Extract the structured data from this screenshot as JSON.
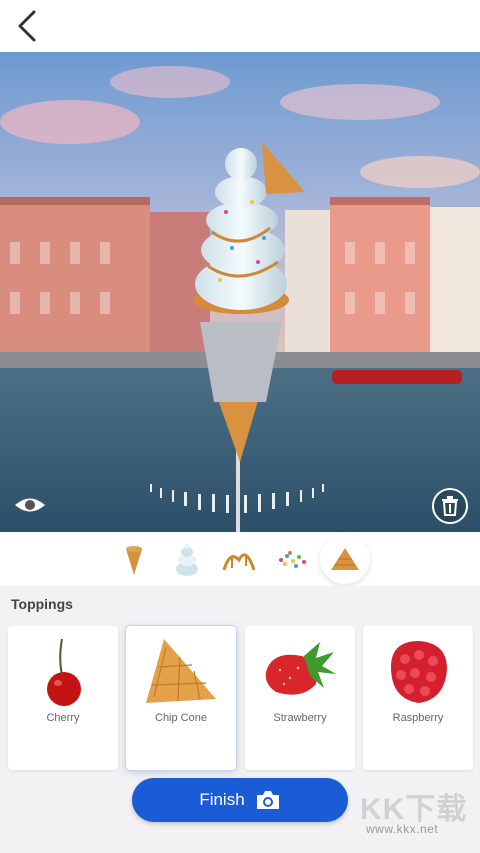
{
  "toppings_section": {
    "title": "Toppings",
    "items": [
      {
        "label": "Cherry",
        "icon": "cherry-icon"
      },
      {
        "label": "Chip Cone",
        "icon": "chip-cone-icon",
        "selected": true
      },
      {
        "label": "Strawberry",
        "icon": "strawberry-icon"
      },
      {
        "label": "Raspberry",
        "icon": "raspberry-icon"
      }
    ]
  },
  "categories": [
    {
      "name": "cone",
      "icon": "cone-icon"
    },
    {
      "name": "ice-cream-swirl",
      "icon": "swirl-icon"
    },
    {
      "name": "syrup",
      "icon": "syrup-drizzle-icon"
    },
    {
      "name": "sprinkles",
      "icon": "sprinkles-icon"
    },
    {
      "name": "toppings",
      "icon": "chip-cone-icon",
      "active": true
    }
  ],
  "finish_button": {
    "label": "Finish",
    "icon": "camera-icon"
  },
  "colors": {
    "accent": "#1a5bd6",
    "background": "#f2f2f4",
    "card": "#ffffff"
  },
  "watermark": {
    "logo": "KK下载",
    "url": "www.kkx.net"
  }
}
